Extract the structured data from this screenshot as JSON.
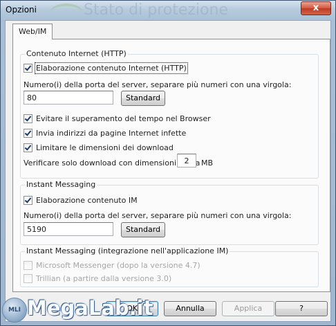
{
  "window": {
    "title": "Opzioni",
    "background_title": "Stato di protezione",
    "close_label": "x"
  },
  "tab": {
    "label": "Web/IM"
  },
  "internet": {
    "group_label": "Contenuto Internet (HTTP)",
    "enable_label": "Elaborazione contenuto Internet (HTTP)",
    "enable_checked": true,
    "port_label": "Numero(i) della porta del server, separare più numeri con una virgola:",
    "port_value": "80",
    "standard_label": "Standard",
    "timeout_label": "Evitare il superamento del tempo nel Browser",
    "timeout_checked": true,
    "infected_label": "Invia indirizzi da pagine Internet infette",
    "infected_checked": true,
    "limit_label": "Limitare  le dimensioni dei download",
    "limit_checked": true,
    "size_prefix": "Verificare solo download con dimensioni fino a",
    "size_value": "2",
    "size_unit": "MB"
  },
  "im": {
    "group_label": "Instant Messaging",
    "enable_label": "Elaborazione contenuto IM",
    "enable_checked": true,
    "port_label": "Numero(i) della porta del server, separare più numeri con una virgola:",
    "port_value": "5190",
    "standard_label": "Standard"
  },
  "integration": {
    "group_label": "Instant Messaging (integrazione nell'applicazione IM)",
    "messenger_label": "Microsoft Messenger (dopo la versione 4.7)",
    "trillian_label": "Trillian (a partire dalla versione 3.0)"
  },
  "buttons": {
    "ok": "OK",
    "cancel": "Annulla",
    "apply": "Applica",
    "help": "?"
  },
  "watermark": {
    "badge": "MLI",
    "text": "MegaLab.it"
  }
}
